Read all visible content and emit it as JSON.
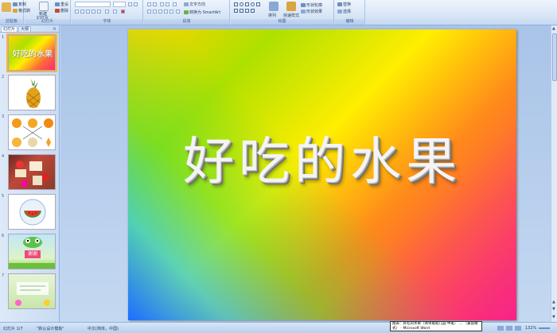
{
  "ribbon": {
    "groups": [
      {
        "name": "clipboard",
        "label": "剪贴板"
      },
      {
        "name": "slides",
        "label": "幻灯片"
      },
      {
        "name": "font",
        "label": "字体"
      },
      {
        "name": "paragraph",
        "label": "段落"
      },
      {
        "name": "drawing",
        "label": "绘图"
      },
      {
        "name": "editing",
        "label": "编辑"
      }
    ],
    "copy_label": "复制",
    "format_painter_label": "格式刷",
    "new_slide_label": "新建",
    "new_slide_sub": "幻灯片",
    "reset_label": "重设",
    "delete_label": "删除",
    "text_direction_label": "文字方向",
    "convert_smartart_label": "转换为 SmartArt",
    "arrange_label": "排列",
    "quick_styles_label": "快速样式",
    "shape_fill_label": "形状轮廓",
    "shape_effects_label": "形状效果",
    "replace_label": "替换",
    "select_label": "选择"
  },
  "panel": {
    "tab_slides": "幻灯片",
    "tab_outline": "大纲",
    "close": "×",
    "thumbnails": [
      {
        "num": "1",
        "title": "好吃的水果"
      },
      {
        "num": "2"
      },
      {
        "num": "3"
      },
      {
        "num": "4"
      },
      {
        "num": "5"
      },
      {
        "num": "6",
        "title": "谢谢"
      },
      {
        "num": "7"
      }
    ]
  },
  "slide": {
    "title": "好吃的水果"
  },
  "status": {
    "slide_count": "幻灯片 1/7",
    "theme": "\"默认设计模板\"",
    "language": "中文(简体，中国)",
    "zoom": "132%"
  },
  "tooltip": {
    "line1": "图表：好吃的水果（简单版幼儿园 中班） ... （兼容模",
    "line2": "式） - Microsoft Word"
  }
}
